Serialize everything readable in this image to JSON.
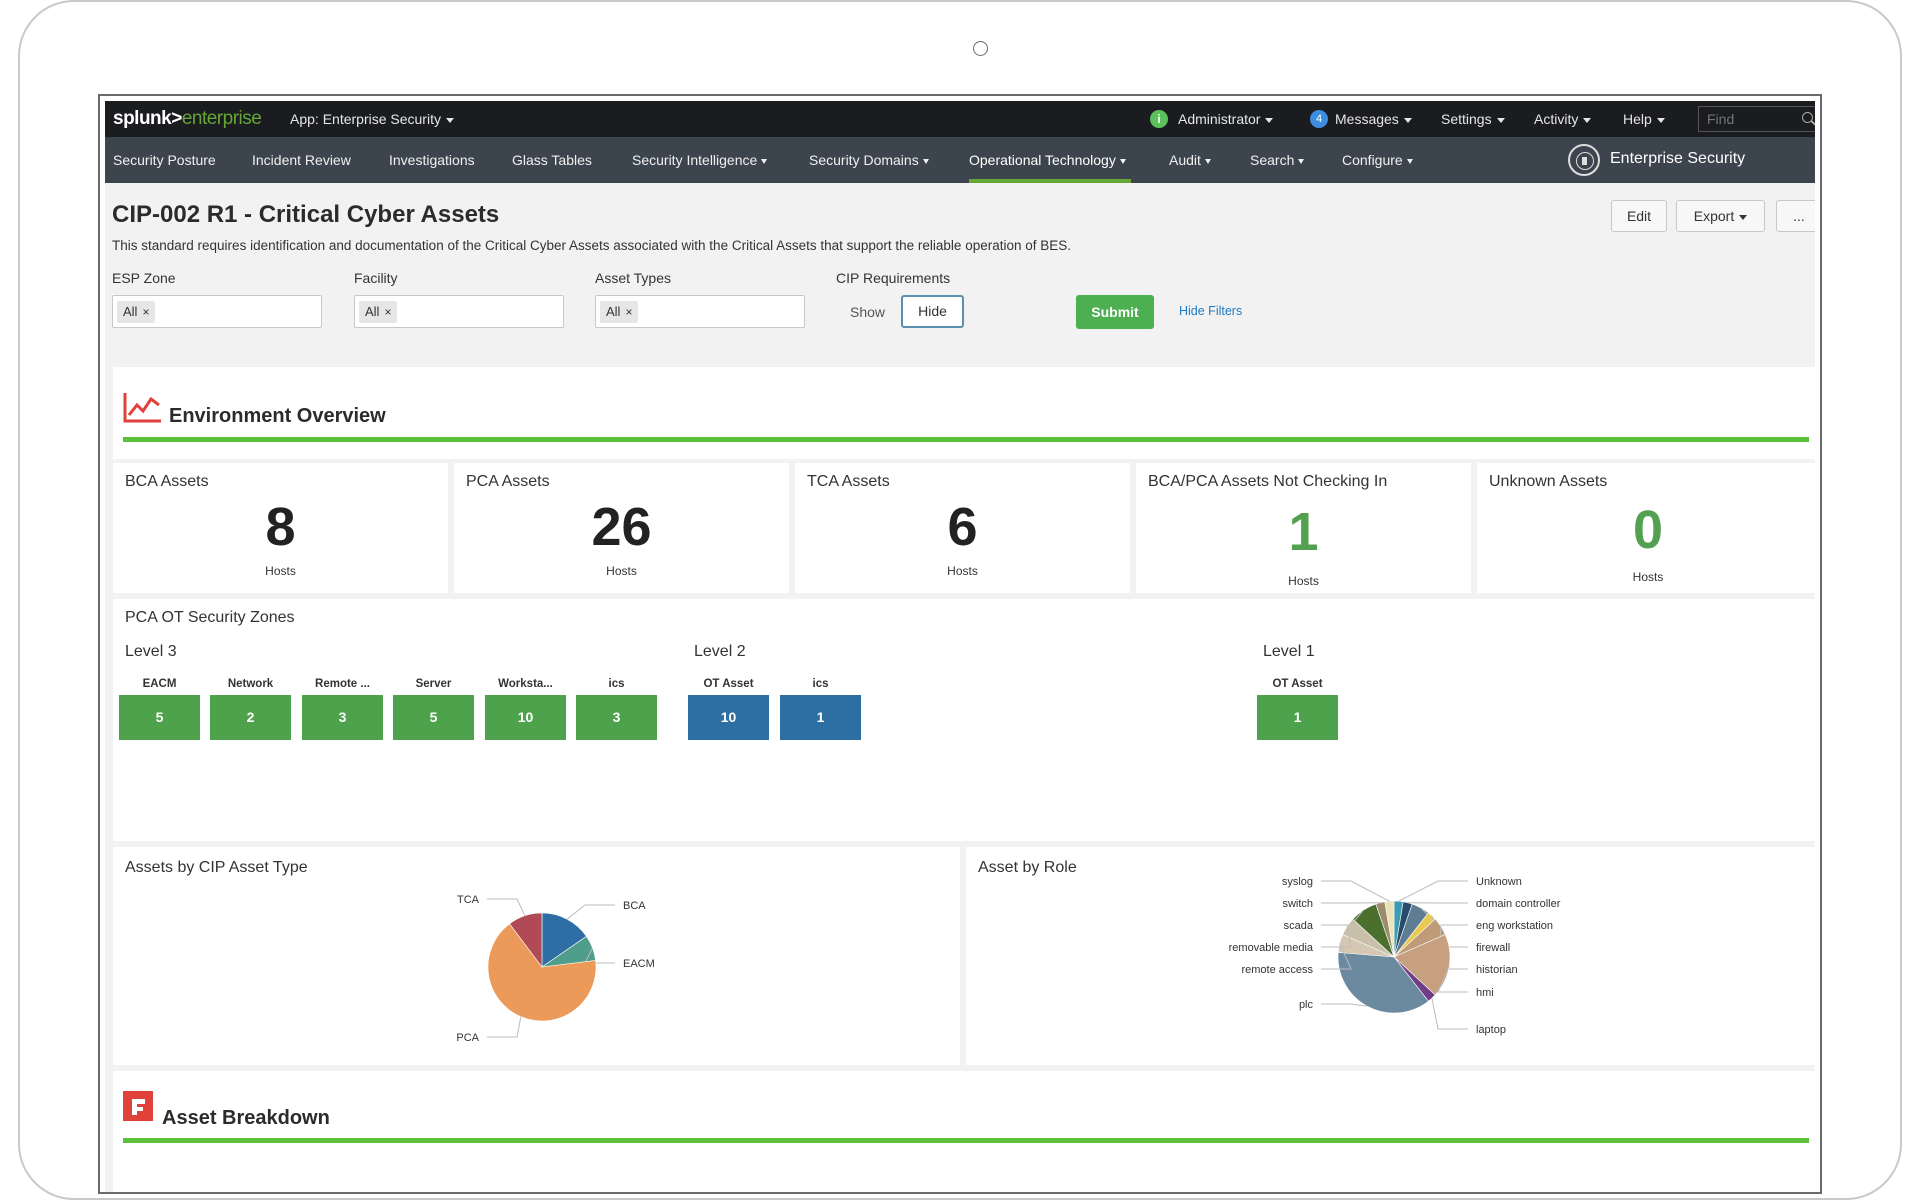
{
  "topbar": {
    "logo_main": "splunk>",
    "logo_suffix": "enterprise",
    "app_menu": "App: Enterprise Security",
    "info_icon": "i",
    "user": "Administrator",
    "messages_count": "4",
    "messages": "Messages",
    "settings": "Settings",
    "activity": "Activity",
    "help": "Help",
    "find_placeholder": "Find"
  },
  "nav": {
    "items": [
      "Security Posture",
      "Incident Review",
      "Investigations",
      "Glass Tables",
      "Security Intelligence",
      "Security Domains",
      "Operational Technology",
      "Audit",
      "Search",
      "Configure"
    ],
    "active": "Operational Technology",
    "app_title": "Enterprise Security"
  },
  "page": {
    "title": "CIP-002 R1 - Critical Cyber Assets",
    "description": "This standard requires identification and documentation of the Critical Cyber Assets associated with the Critical Assets that support the reliable operation of BES.",
    "edit": "Edit",
    "export": "Export",
    "more": "..."
  },
  "filters": {
    "esp_zone": {
      "label": "ESP Zone",
      "token": "All"
    },
    "facility": {
      "label": "Facility",
      "token": "All"
    },
    "asset_types": {
      "label": "Asset Types",
      "token": "All"
    },
    "cip": {
      "label": "CIP Requirements",
      "show": "Show",
      "hide": "Hide"
    },
    "submit": "Submit",
    "hide_filters": "Hide Filters",
    "token_remove": "×"
  },
  "overview": {
    "title": "Environment Overview",
    "kpis": [
      {
        "title": "BCA Assets",
        "value": "8",
        "unit": "Hosts"
      },
      {
        "title": "PCA Assets",
        "value": "26",
        "unit": "Hosts"
      },
      {
        "title": "TCA Assets",
        "value": "6",
        "unit": "Hosts"
      },
      {
        "title": "BCA/PCA Assets Not Checking In",
        "value": "1",
        "unit": "Hosts"
      },
      {
        "title": "Unknown Assets",
        "value": "0",
        "unit": "Hosts"
      }
    ]
  },
  "zones": {
    "title": "PCA OT Security Zones",
    "levels": [
      {
        "name": "Level 3",
        "tiles": [
          {
            "label": "EACM",
            "value": "5"
          },
          {
            "label": "Network",
            "value": "2"
          },
          {
            "label": "Remote ...",
            "value": "3"
          },
          {
            "label": "Server",
            "value": "5"
          },
          {
            "label": "Worksta...",
            "value": "10"
          },
          {
            "label": "ics",
            "value": "3"
          }
        ]
      },
      {
        "name": "Level 2",
        "tiles": [
          {
            "label": "OT Asset",
            "value": "10"
          },
          {
            "label": "ics",
            "value": "1"
          }
        ]
      },
      {
        "name": "Level 1",
        "tiles": [
          {
            "label": "OT Asset",
            "value": "1"
          }
        ]
      }
    ]
  },
  "chart_data": [
    {
      "type": "pie",
      "title": "Assets by CIP Asset Type",
      "categories": [
        "BCA",
        "EACM",
        "PCA",
        "TCA"
      ],
      "values": [
        6,
        3,
        26,
        4
      ],
      "colors": [
        "#2f6ea4",
        "#4f9e8b",
        "#ec9a59",
        "#b04b55"
      ]
    },
    {
      "type": "pie",
      "title": "Asset by Role",
      "categories": [
        "Unknown",
        "domain controller",
        "eng workstation",
        "firewall",
        "historian",
        "hmi",
        "laptop",
        "plc",
        "remote access",
        "removable media",
        "scada",
        "switch",
        "syslog"
      ],
      "values": [
        1,
        1,
        2,
        1,
        2,
        7,
        1,
        14,
        2,
        2,
        3,
        1,
        1
      ],
      "colors": [
        "#3d9bb3",
        "#274c6b",
        "#5e7d93",
        "#eac950",
        "#c09b78",
        "#c6a081",
        "#6f3e87",
        "#6b8aa0",
        "#d6c7b3",
        "#c8c0a8",
        "#4b6f2d",
        "#9a8c6c",
        "#ece2b8"
      ]
    }
  ],
  "breakdown": {
    "title": "Asset Breakdown"
  }
}
